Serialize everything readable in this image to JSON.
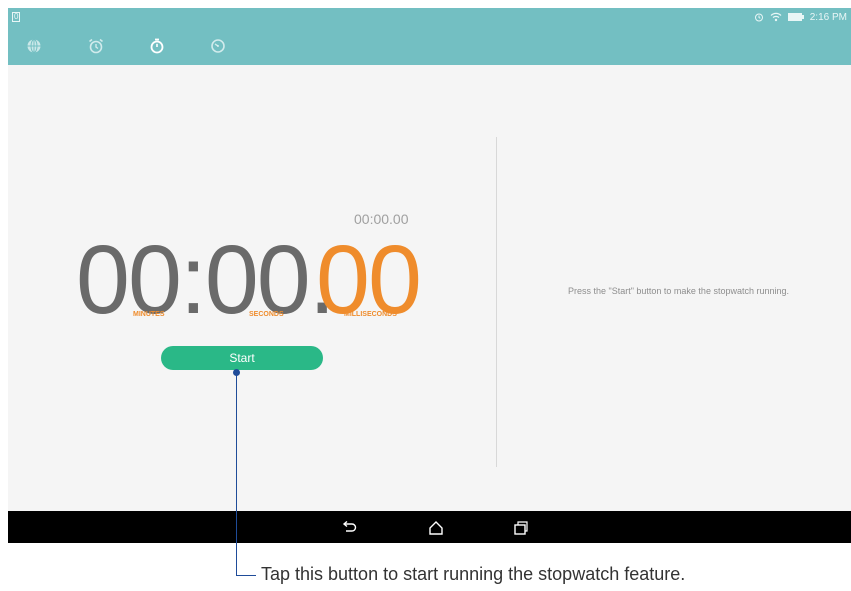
{
  "status_bar": {
    "left_badge": "0",
    "time": "2:16 PM",
    "icons": [
      "alarm-icon",
      "wifi-icon",
      "battery-icon"
    ]
  },
  "tabs": [
    {
      "name": "world-clock",
      "icon": "globe-icon"
    },
    {
      "name": "alarm",
      "icon": "alarm-clock-icon"
    },
    {
      "name": "stopwatch",
      "icon": "stopwatch-icon",
      "selected": true
    },
    {
      "name": "timer",
      "icon": "timer-icon"
    }
  ],
  "stopwatch": {
    "lap_time": "00:00.00",
    "time_main": "00:00.",
    "time_ms": "00",
    "labels": {
      "minutes": "MINUTES",
      "seconds": "SECONDS",
      "milliseconds": "MILLISECONDS"
    },
    "start_label": "Start",
    "hint": "Press the \"Start\" button to make the stopwatch running."
  },
  "nav": {
    "buttons": [
      "back-icon",
      "home-icon",
      "recent-apps-icon"
    ]
  },
  "annotation": {
    "text": "Tap this button to start running the stopwatch feature."
  },
  "colors": {
    "topbar": "#73bfc2",
    "accent_orange": "#ef8c2c",
    "start_green": "#2ab887",
    "callout_blue": "#1f4c99"
  }
}
